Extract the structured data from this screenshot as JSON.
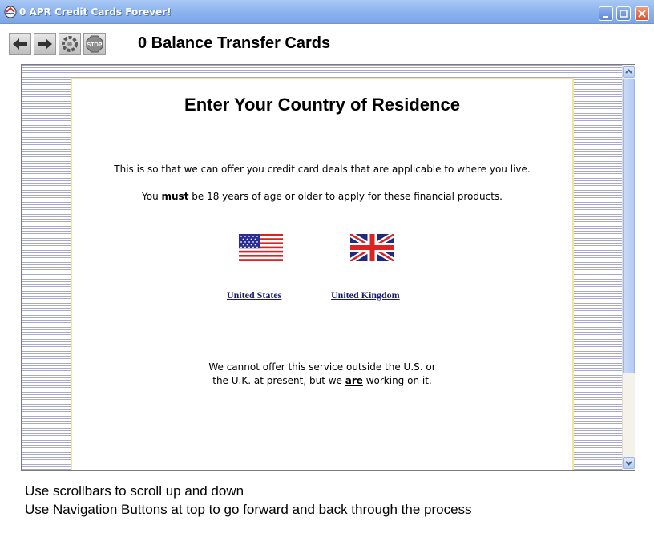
{
  "window": {
    "title": "0 APR Credit Cards Forever!"
  },
  "toolbar": {
    "title": "0 Balance Transfer Cards",
    "buttons": [
      {
        "name": "back",
        "icon": "arrow-left-icon"
      },
      {
        "name": "forward",
        "icon": "arrow-right-icon"
      },
      {
        "name": "refresh",
        "icon": "refresh-icon"
      },
      {
        "name": "stop",
        "icon": "stop-icon",
        "label": "STOP"
      }
    ]
  },
  "page": {
    "heading": "Enter Your Country of Residence",
    "line1": "This is so that we can offer you credit card deals that are applicable to where you live.",
    "line2_pre": "You ",
    "line2_bold": "must",
    "line2_post": " be 18 years of age or older to apply for these financial products.",
    "countries": [
      {
        "label": "United States",
        "flag": "us-flag-icon"
      },
      {
        "label": "United Kingdom",
        "flag": "uk-flag-icon"
      }
    ],
    "notice_line1": "We cannot offer this service outside the U.S. or",
    "notice_line2_pre": "the U.K. at present, but we ",
    "notice_line2_bold": "are",
    "notice_line2_post": " working on it."
  },
  "instructions": {
    "line1": "Use scrollbars to scroll up and down",
    "line2": "Use Navigation Buttons at top to go forward and back through the process"
  },
  "colors": {
    "titlebar": "#8fb6ef",
    "link": "#1a1a6e",
    "page_border": "#f0e890"
  }
}
